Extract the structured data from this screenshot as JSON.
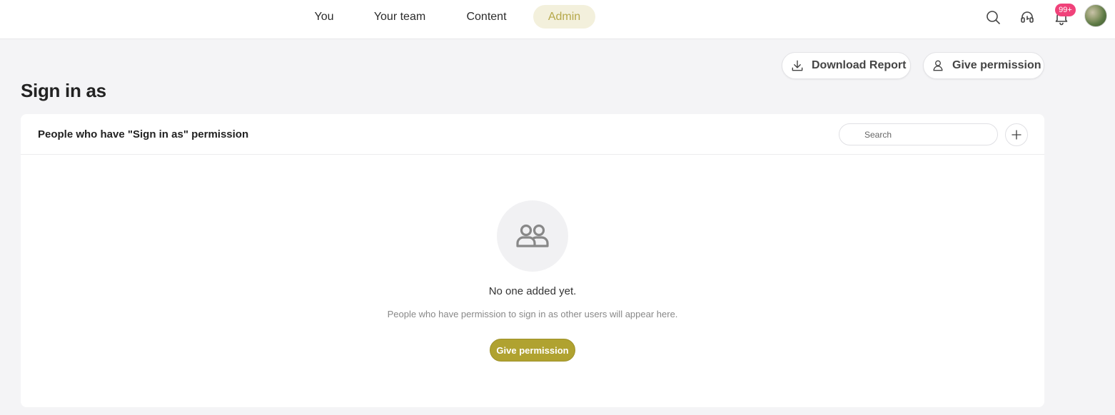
{
  "nav": {
    "tabs": [
      {
        "label": "You",
        "active": false
      },
      {
        "label": "Your team",
        "active": false
      },
      {
        "label": "Content",
        "active": false
      },
      {
        "label": "Admin",
        "active": true
      }
    ],
    "notification_count": "99+",
    "icons": [
      "search-icon",
      "headset-icon",
      "bell-icon"
    ],
    "accent_color": "#b6a84a"
  },
  "header": {
    "download_report_label": "Download Report",
    "give_permission_label": "Give permission",
    "page_title": "Sign in as"
  },
  "card": {
    "title": "People who have \"Sign in as\" permission",
    "search": {
      "placeholder": "Search",
      "value": ""
    },
    "empty_state": {
      "title": "No one added yet.",
      "description": "People who have permission to sign in as other users will appear here.",
      "button_label": "Give permission",
      "button_color": "#b0a230"
    }
  }
}
